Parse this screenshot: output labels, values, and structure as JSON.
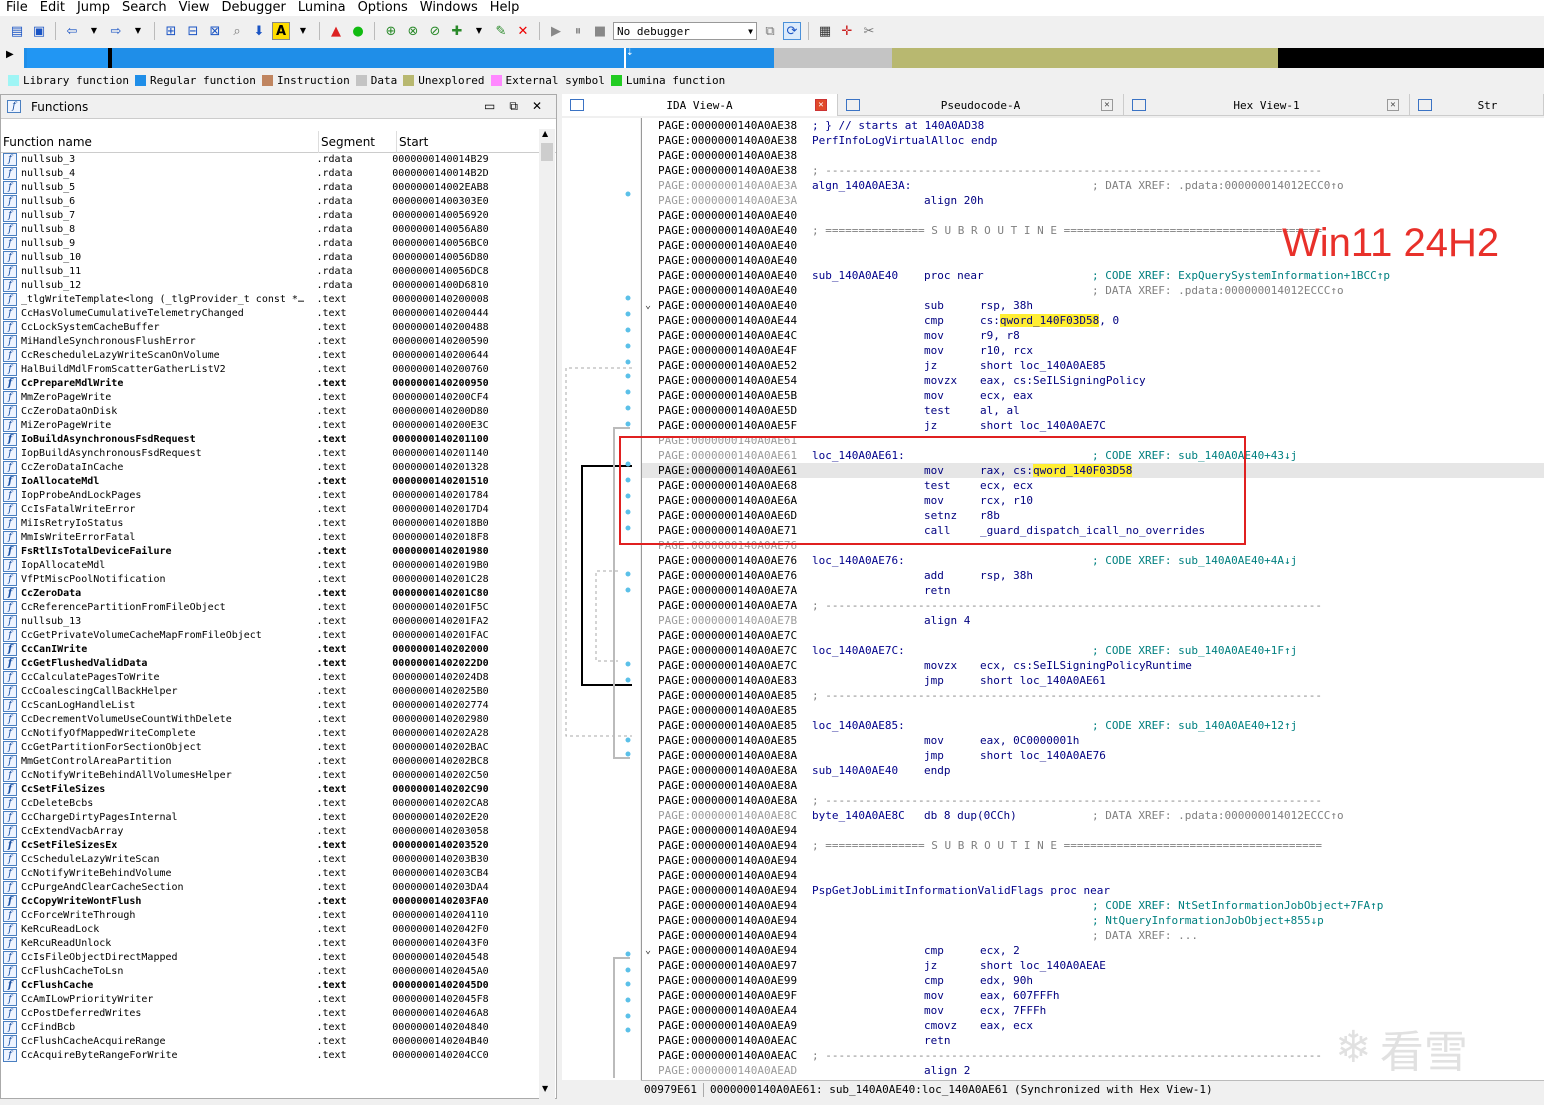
{
  "menu": [
    "File",
    "Edit",
    "Jump",
    "Search",
    "View",
    "Debugger",
    "Lumina",
    "Options",
    "Windows",
    "Help"
  ],
  "toolbar": {
    "debugger_select": "No debugger",
    "icons": [
      "open-icon",
      "save-icon",
      "back-icon",
      "forward-icon",
      "binary-icon",
      "hex-icon",
      "text-icon",
      "search-icon",
      "down-arrow-icon",
      "font-icon",
      "stop-icon",
      "go-icon",
      "run-icon",
      "run-to-icon",
      "step-icon",
      "step-over-icon",
      "edit-icon",
      "cancel-icon",
      "play-icon",
      "pause-icon",
      "stop-debug-icon",
      "attach-icon",
      "sync-icon",
      "graph-icon",
      "add-icon",
      "tools-icon"
    ]
  },
  "navbar_colors": {
    "library": "#70ffff",
    "regular": "#1f8ee8",
    "instruction": "#c08560",
    "data": "#c4c4c4",
    "unexplored": "#b8b870",
    "external": "#ff88ff",
    "lumina": "#22cc22",
    "gap": "#000000"
  },
  "legend": [
    {
      "label": "Library function",
      "color": "#9ff5f5"
    },
    {
      "label": "Regular function",
      "color": "#1f8ee8"
    },
    {
      "label": "Instruction",
      "color": "#c08560"
    },
    {
      "label": "Data",
      "color": "#c4c4c4"
    },
    {
      "label": "Unexplored",
      "color": "#b8b870"
    },
    {
      "label": "External symbol",
      "color": "#ff88ff"
    },
    {
      "label": "Lumina function",
      "color": "#22cc22"
    }
  ],
  "functions": {
    "title": "Functions",
    "columns": [
      "Function name",
      "Segment",
      "Start"
    ],
    "rows": [
      {
        "name": "nullsub_3",
        "seg": ".rdata",
        "start": "0000000140014B29",
        "bold": false
      },
      {
        "name": "nullsub_4",
        "seg": ".rdata",
        "start": "0000000140014B2D",
        "bold": false
      },
      {
        "name": "nullsub_5",
        "seg": ".rdata",
        "start": "000000014002EAB8",
        "bold": false
      },
      {
        "name": "nullsub_6",
        "seg": ".rdata",
        "start": "00000001400303E0",
        "bold": false
      },
      {
        "name": "nullsub_7",
        "seg": ".rdata",
        "start": "0000000140056920",
        "bold": false
      },
      {
        "name": "nullsub_8",
        "seg": ".rdata",
        "start": "0000000140056A80",
        "bold": false
      },
      {
        "name": "nullsub_9",
        "seg": ".rdata",
        "start": "0000000140056BC0",
        "bold": false
      },
      {
        "name": "nullsub_10",
        "seg": ".rdata",
        "start": "0000000140056D80",
        "bold": false
      },
      {
        "name": "nullsub_11",
        "seg": ".rdata",
        "start": "0000000140056DC8",
        "bold": false
      },
      {
        "name": "nullsub_12",
        "seg": ".rdata",
        "start": "00000001400D6810",
        "bold": false
      },
      {
        "name": "_tlgWriteTemplate<long (_tlgProvider_t const *…",
        "seg": ".text",
        "start": "0000000140200008",
        "bold": false
      },
      {
        "name": "CcHasVolumeCumulativeTelemetryChanged",
        "seg": ".text",
        "start": "0000000140200444",
        "bold": false
      },
      {
        "name": "CcLockSystemCacheBuffer",
        "seg": ".text",
        "start": "0000000140200488",
        "bold": false
      },
      {
        "name": "MiHandleSynchronousFlushError",
        "seg": ".text",
        "start": "0000000140200590",
        "bold": false
      },
      {
        "name": "CcRescheduleLazyWriteScanOnVolume",
        "seg": ".text",
        "start": "0000000140200644",
        "bold": false
      },
      {
        "name": "HalBuildMdlFromScatterGatherListV2",
        "seg": ".text",
        "start": "0000000140200760",
        "bold": false
      },
      {
        "name": "CcPrepareMdlWrite",
        "seg": ".text",
        "start": "0000000140200950",
        "bold": true
      },
      {
        "name": "MmZeroPageWrite",
        "seg": ".text",
        "start": "0000000140200CF4",
        "bold": false
      },
      {
        "name": "CcZeroDataOnDisk",
        "seg": ".text",
        "start": "0000000140200D80",
        "bold": false
      },
      {
        "name": "MiZeroPageWrite",
        "seg": ".text",
        "start": "0000000140200E3C",
        "bold": false
      },
      {
        "name": "IoBuildAsynchronousFsdRequest",
        "seg": ".text",
        "start": "0000000140201100",
        "bold": true
      },
      {
        "name": "IopBuildAsynchronousFsdRequest",
        "seg": ".text",
        "start": "0000000140201140",
        "bold": false
      },
      {
        "name": "CcZeroDataInCache",
        "seg": ".text",
        "start": "0000000140201328",
        "bold": false
      },
      {
        "name": "IoAllocateMdl",
        "seg": ".text",
        "start": "0000000140201510",
        "bold": true
      },
      {
        "name": "IopProbeAndLockPages",
        "seg": ".text",
        "start": "0000000140201784",
        "bold": false
      },
      {
        "name": "CcIsFatalWriteError",
        "seg": ".text",
        "start": "00000001402017D4",
        "bold": false
      },
      {
        "name": "MiIsRetryIoStatus",
        "seg": ".text",
        "start": "00000001402018B0",
        "bold": false
      },
      {
        "name": "MmIsWriteErrorFatal",
        "seg": ".text",
        "start": "00000001402018F8",
        "bold": false
      },
      {
        "name": "FsRtlIsTotalDeviceFailure",
        "seg": ".text",
        "start": "0000000140201980",
        "bold": true
      },
      {
        "name": "IopAllocateMdl",
        "seg": ".text",
        "start": "00000001402019B0",
        "bold": false
      },
      {
        "name": "VfPtMiscPoolNotification",
        "seg": ".text",
        "start": "0000000140201C28",
        "bold": false
      },
      {
        "name": "CcZeroData",
        "seg": ".text",
        "start": "0000000140201C80",
        "bold": true
      },
      {
        "name": "CcReferencePartitionFromFileObject",
        "seg": ".text",
        "start": "0000000140201F5C",
        "bold": false
      },
      {
        "name": "nullsub_13",
        "seg": ".text",
        "start": "0000000140201FA2",
        "bold": false
      },
      {
        "name": "CcGetPrivateVolumeCacheMapFromFileObject",
        "seg": ".text",
        "start": "0000000140201FAC",
        "bold": false
      },
      {
        "name": "CcCanIWrite",
        "seg": ".text",
        "start": "0000000140202000",
        "bold": true
      },
      {
        "name": "CcGetFlushedValidData",
        "seg": ".text",
        "start": "00000001402022D0",
        "bold": true
      },
      {
        "name": "CcCalculatePagesToWrite",
        "seg": ".text",
        "start": "00000001402024D8",
        "bold": false
      },
      {
        "name": "CcCoalescingCallBackHelper",
        "seg": ".text",
        "start": "00000001402025B0",
        "bold": false
      },
      {
        "name": "CcScanLogHandleList",
        "seg": ".text",
        "start": "0000000140202774",
        "bold": false
      },
      {
        "name": "CcDecrementVolumeUseCountWithDelete",
        "seg": ".text",
        "start": "0000000140202980",
        "bold": false
      },
      {
        "name": "CcNotifyOfMappedWriteComplete",
        "seg": ".text",
        "start": "0000000140202A28",
        "bold": false
      },
      {
        "name": "CcGetPartitionForSectionObject",
        "seg": ".text",
        "start": "0000000140202BAC",
        "bold": false
      },
      {
        "name": "MmGetControlAreaPartition",
        "seg": ".text",
        "start": "0000000140202BC8",
        "bold": false
      },
      {
        "name": "CcNotifyWriteBehindAllVolumesHelper",
        "seg": ".text",
        "start": "0000000140202C50",
        "bold": false
      },
      {
        "name": "CcSetFileSizes",
        "seg": ".text",
        "start": "0000000140202C90",
        "bold": true
      },
      {
        "name": "CcDeleteBcbs",
        "seg": ".text",
        "start": "0000000140202CA8",
        "bold": false
      },
      {
        "name": "CcChargeDirtyPagesInternal",
        "seg": ".text",
        "start": "0000000140202E20",
        "bold": false
      },
      {
        "name": "CcExtendVacbArray",
        "seg": ".text",
        "start": "0000000140203058",
        "bold": false
      },
      {
        "name": "CcSetFileSizesEx",
        "seg": ".text",
        "start": "0000000140203520",
        "bold": true
      },
      {
        "name": "CcScheduleLazyWriteScan",
        "seg": ".text",
        "start": "0000000140203B30",
        "bold": false
      },
      {
        "name": "CcNotifyWriteBehindVolume",
        "seg": ".text",
        "start": "0000000140203CB4",
        "bold": false
      },
      {
        "name": "CcPurgeAndClearCacheSection",
        "seg": ".text",
        "start": "0000000140203DA4",
        "bold": false
      },
      {
        "name": "CcCopyWriteWontFlush",
        "seg": ".text",
        "start": "0000000140203FA0",
        "bold": true
      },
      {
        "name": "CcForceWriteThrough",
        "seg": ".text",
        "start": "0000000140204110",
        "bold": false
      },
      {
        "name": "KeRcuReadLock",
        "seg": ".text",
        "start": "00000001402042F0",
        "bold": false
      },
      {
        "name": "KeRcuReadUnlock",
        "seg": ".text",
        "start": "00000001402043F0",
        "bold": false
      },
      {
        "name": "CcIsFileObjectDirectMapped",
        "seg": ".text",
        "start": "0000000140204548",
        "bold": false
      },
      {
        "name": "CcFlushCacheToLsn",
        "seg": ".text",
        "start": "00000001402045A0",
        "bold": false
      },
      {
        "name": "CcFlushCache",
        "seg": ".text",
        "start": "00000001402045D0",
        "bold": true
      },
      {
        "name": "CcAmILowPriorityWriter",
        "seg": ".text",
        "start": "00000001402045F8",
        "bold": false
      },
      {
        "name": "CcPostDeferredWrites",
        "seg": ".text",
        "start": "00000001402046A8",
        "bold": false
      },
      {
        "name": "CcFindBcb",
        "seg": ".text",
        "start": "0000000140204840",
        "bold": false
      },
      {
        "name": "CcFlushCacheAcquireRange",
        "seg": ".text",
        "start": "0000000140204B40",
        "bold": false
      },
      {
        "name": "CcAcquireByteRangeForWrite",
        "seg": ".text",
        "start": "0000000140204CC0",
        "bold": false
      }
    ]
  },
  "tabs": [
    {
      "label": "IDA View-A",
      "active": true
    },
    {
      "label": "Pseudocode-A",
      "active": false
    },
    {
      "label": "Hex View-1",
      "active": false
    },
    {
      "label": "Str",
      "active": false
    }
  ],
  "listing": [
    {
      "a": "PAGE:0000000140A0AE38",
      "t": "text",
      "txt": "; } // starts at 140A0AD38"
    },
    {
      "a": "PAGE:0000000140A0AE38",
      "t": "text",
      "txt": "PerfInfoLogVirtualAlloc endp"
    },
    {
      "a": "PAGE:0000000140A0AE38",
      "t": "blank"
    },
    {
      "a": "PAGE:0000000140A0AE38",
      "t": "sep",
      "txt": "; ---------------------------------------------------------------------------"
    },
    {
      "a": "PAGE:0000000140A0AE3A",
      "t": "lbl",
      "gray": true,
      "lbl": "algn_140A0AE3A:",
      "xr": "; DATA XREF: .pdata:000000014012ECC0↑o",
      "xrgray": true
    },
    {
      "a": "PAGE:0000000140A0AE3A",
      "t": "ins",
      "gray": true,
      "mn": "align 20h"
    },
    {
      "a": "PAGE:0000000140A0AE40",
      "t": "blank"
    },
    {
      "a": "PAGE:0000000140A0AE40",
      "t": "sep",
      "txt": "; =============== S U B R O U T I N E ======================================="
    },
    {
      "a": "PAGE:0000000140A0AE40",
      "t": "blank"
    },
    {
      "a": "PAGE:0000000140A0AE40",
      "t": "blank"
    },
    {
      "a": "PAGE:0000000140A0AE40",
      "t": "lbl",
      "lbl": "sub_140A0AE40",
      "mn": "proc near",
      "xr": "; CODE XREF: ExpQuerySystemInformation+1BCC↑p"
    },
    {
      "a": "PAGE:0000000140A0AE40",
      "t": "lbl",
      "xr": "; DATA XREF: .pdata:000000014012ECCC↑o",
      "xrgray": true
    },
    {
      "a": "PAGE:0000000140A0AE40",
      "t": "ins",
      "fold": true,
      "mn": "sub",
      "op": "rsp, 38h"
    },
    {
      "a": "PAGE:0000000140A0AE44",
      "t": "ins",
      "mn": "cmp",
      "op_pre": "cs:",
      "op_hl": "qword_140F03D58",
      "op_post": ", 0"
    },
    {
      "a": "PAGE:0000000140A0AE4C",
      "t": "ins",
      "mn": "mov",
      "op": "r9, r8"
    },
    {
      "a": "PAGE:0000000140A0AE4F",
      "t": "ins",
      "mn": "mov",
      "op": "r10, rcx"
    },
    {
      "a": "PAGE:0000000140A0AE52",
      "t": "ins",
      "mn": "jz",
      "op": "short loc_140A0AE85"
    },
    {
      "a": "PAGE:0000000140A0AE54",
      "t": "ins",
      "mn": "movzx",
      "op": "eax, cs:SeILSigningPolicy"
    },
    {
      "a": "PAGE:0000000140A0AE5B",
      "t": "ins",
      "mn": "mov",
      "op": "ecx, eax"
    },
    {
      "a": "PAGE:0000000140A0AE5D",
      "t": "ins",
      "mn": "test",
      "op": "al, al"
    },
    {
      "a": "PAGE:0000000140A0AE5F",
      "t": "ins",
      "mn": "jz",
      "op": "short loc_140A0AE7C"
    },
    {
      "a": "PAGE:0000000140A0AE61",
      "t": "blank",
      "gray": true
    },
    {
      "a": "PAGE:0000000140A0AE61",
      "t": "lbl",
      "gray": true,
      "lbl": "loc_140A0AE61:",
      "xr": "; CODE XREF: sub_140A0AE40+43↓j"
    },
    {
      "a": "PAGE:0000000140A0AE61",
      "t": "ins",
      "hl": true,
      "mn": "mov",
      "op_pre": "rax, cs:",
      "op_hl": "qword_140F03D58",
      "op_post": ""
    },
    {
      "a": "PAGE:0000000140A0AE68",
      "t": "ins",
      "mn": "test",
      "op": "ecx, ecx"
    },
    {
      "a": "PAGE:0000000140A0AE6A",
      "t": "ins",
      "mn": "mov",
      "op": "rcx, r10"
    },
    {
      "a": "PAGE:0000000140A0AE6D",
      "t": "ins",
      "mn": "setnz",
      "op": "r8b"
    },
    {
      "a": "PAGE:0000000140A0AE71",
      "t": "ins",
      "mn": "call",
      "op": "_guard_dispatch_icall_no_overrides"
    },
    {
      "a": "PAGE:0000000140A0AE76",
      "t": "blank",
      "gray": true
    },
    {
      "a": "PAGE:0000000140A0AE76",
      "t": "lbl",
      "lbl": "loc_140A0AE76:",
      "xr": "; CODE XREF: sub_140A0AE40+4A↓j"
    },
    {
      "a": "PAGE:0000000140A0AE76",
      "t": "ins",
      "mn": "add",
      "op": "rsp, 38h"
    },
    {
      "a": "PAGE:0000000140A0AE7A",
      "t": "ins",
      "mn": "retn"
    },
    {
      "a": "PAGE:0000000140A0AE7A",
      "t": "sep",
      "txt": "; ---------------------------------------------------------------------------"
    },
    {
      "a": "PAGE:0000000140A0AE7B",
      "t": "ins",
      "gray": true,
      "mn": "align 4"
    },
    {
      "a": "PAGE:0000000140A0AE7C",
      "t": "blank"
    },
    {
      "a": "PAGE:0000000140A0AE7C",
      "t": "lbl",
      "lbl": "loc_140A0AE7C:",
      "xr": "; CODE XREF: sub_140A0AE40+1F↑j"
    },
    {
      "a": "PAGE:0000000140A0AE7C",
      "t": "ins",
      "mn": "movzx",
      "op": "ecx, cs:SeILSigningPolicyRuntime"
    },
    {
      "a": "PAGE:0000000140A0AE83",
      "t": "ins",
      "mn": "jmp",
      "op": "short loc_140A0AE61"
    },
    {
      "a": "PAGE:0000000140A0AE85",
      "t": "sep",
      "txt": "; ---------------------------------------------------------------------------"
    },
    {
      "a": "PAGE:0000000140A0AE85",
      "t": "blank"
    },
    {
      "a": "PAGE:0000000140A0AE85",
      "t": "lbl",
      "lbl": "loc_140A0AE85:",
      "xr": "; CODE XREF: sub_140A0AE40+12↑j"
    },
    {
      "a": "PAGE:0000000140A0AE85",
      "t": "ins",
      "mn": "mov",
      "op": "eax, 0C0000001h"
    },
    {
      "a": "PAGE:0000000140A0AE8A",
      "t": "ins",
      "mn": "jmp",
      "op": "short loc_140A0AE76"
    },
    {
      "a": "PAGE:0000000140A0AE8A",
      "t": "lbl",
      "lbl": "sub_140A0AE40",
      "mn": "endp"
    },
    {
      "a": "PAGE:0000000140A0AE8A",
      "t": "blank"
    },
    {
      "a": "PAGE:0000000140A0AE8A",
      "t": "sep",
      "txt": "; ---------------------------------------------------------------------------"
    },
    {
      "a": "PAGE:0000000140A0AE8C",
      "t": "lbl",
      "gray": true,
      "lbl": "byte_140A0AE8C",
      "mnraw": "db 8 dup(0CCh)",
      "xr": "; DATA XREF: .pdata:000000014012ECCC↑o",
      "xrgray": true
    },
    {
      "a": "PAGE:0000000140A0AE94",
      "t": "blank"
    },
    {
      "a": "PAGE:0000000140A0AE94",
      "t": "sep",
      "txt": "; =============== S U B R O U T I N E ======================================="
    },
    {
      "a": "PAGE:0000000140A0AE94",
      "t": "blank"
    },
    {
      "a": "PAGE:0000000140A0AE94",
      "t": "blank"
    },
    {
      "a": "PAGE:0000000140A0AE94",
      "t": "lbl",
      "lbl": "PspGetJobLimitInformationValidFlags proc near"
    },
    {
      "a": "PAGE:0000000140A0AE94",
      "t": "lbl",
      "xr": "; CODE XREF: NtSetInformationJobObject+7FA↑p"
    },
    {
      "a": "PAGE:0000000140A0AE94",
      "t": "lbl",
      "xr": "; NtQueryInformationJobObject+855↓p"
    },
    {
      "a": "PAGE:0000000140A0AE94",
      "t": "lbl",
      "xr": "; DATA XREF: ...",
      "xrgray": true
    },
    {
      "a": "PAGE:0000000140A0AE94",
      "t": "ins",
      "fold": true,
      "mn": "cmp",
      "op": "ecx, 2"
    },
    {
      "a": "PAGE:0000000140A0AE97",
      "t": "ins",
      "mn": "jz",
      "op": "short loc_140A0AEAE"
    },
    {
      "a": "PAGE:0000000140A0AE99",
      "t": "ins",
      "mn": "cmp",
      "op": "edx, 90h"
    },
    {
      "a": "PAGE:0000000140A0AE9F",
      "t": "ins",
      "mn": "mov",
      "op": "eax, 607FFFh"
    },
    {
      "a": "PAGE:0000000140A0AEA4",
      "t": "ins",
      "mn": "mov",
      "op": "ecx, 7FFFh"
    },
    {
      "a": "PAGE:0000000140A0AEA9",
      "t": "ins",
      "mn": "cmovz",
      "op": "eax, ecx"
    },
    {
      "a": "PAGE:0000000140A0AEAC",
      "t": "ins",
      "mn": "retn"
    },
    {
      "a": "PAGE:0000000140A0AEAC",
      "t": "sep",
      "txt": "; ---------------------------------------------------------------------------"
    },
    {
      "a": "PAGE:0000000140A0AEAD",
      "t": "ins",
      "gray": true,
      "mn": "align 2"
    }
  ],
  "annotation": "Win11 24H2",
  "status": {
    "offset": "00979E61",
    "location": "0000000140A0AE61: sub_140A0AE40:loc_140A0AE61",
    "sync": "(Synchronized with Hex View-1)"
  },
  "watermark": "看雪"
}
